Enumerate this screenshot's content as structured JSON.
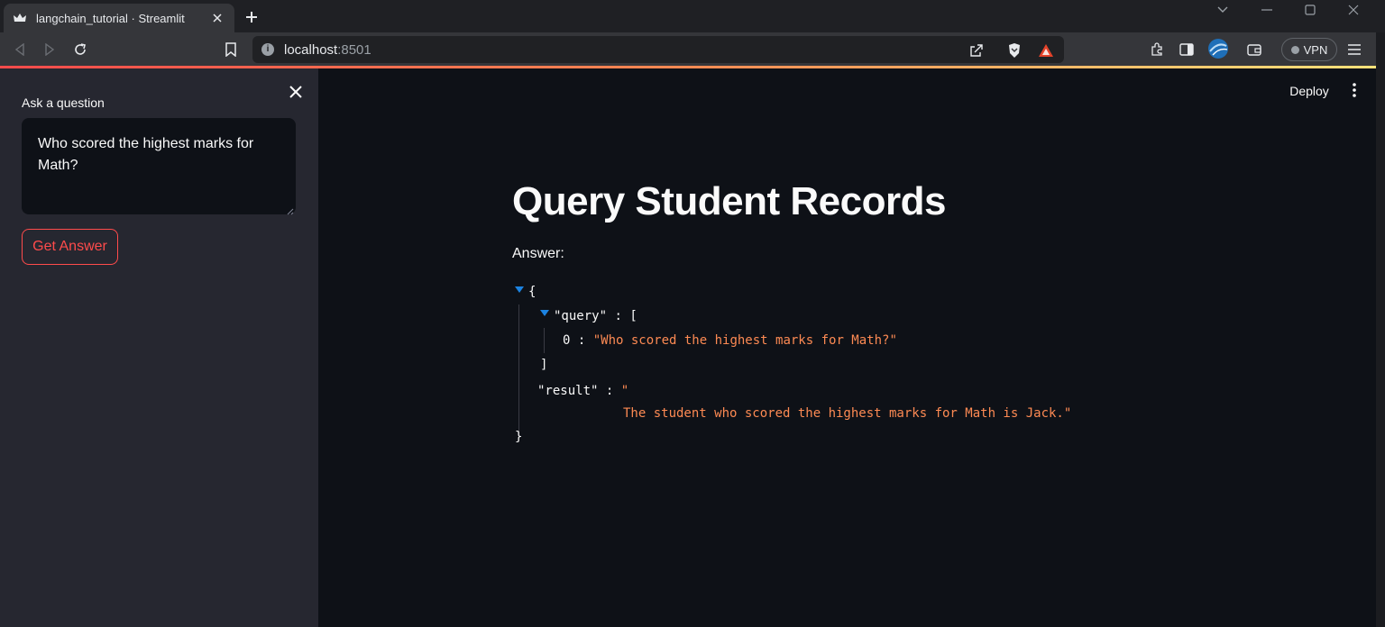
{
  "browser": {
    "tab_title": "langchain_tutorial · Streamlit",
    "url_host": "localhost",
    "url_port": ":8501",
    "vpn_label": "VPN"
  },
  "sidebar": {
    "question_label": "Ask a question",
    "question_value": "Who scored the highest marks for Math?",
    "button_label": "Get Answer"
  },
  "header": {
    "deploy_label": "Deploy"
  },
  "main": {
    "title": "Query Student Records",
    "answer_label": "Answer:",
    "json": {
      "open_brace": "{",
      "query_key": "\"query\"",
      "colon": " : ",
      "open_bracket": "[",
      "item_index": "0",
      "item_value": "\"Who scored the highest marks for Math?\"",
      "close_bracket": "]",
      "result_key": "\"result\"",
      "result_open_quote": "\"",
      "result_value": "The student who scored the highest marks for Math is Jack.\"",
      "close_brace": "}"
    }
  },
  "colors": {
    "accent": "#ff4b4b",
    "string": "#fd8a53",
    "expander": "#1c83e1",
    "sidebar_bg": "#262730",
    "main_bg": "#0e1117"
  }
}
